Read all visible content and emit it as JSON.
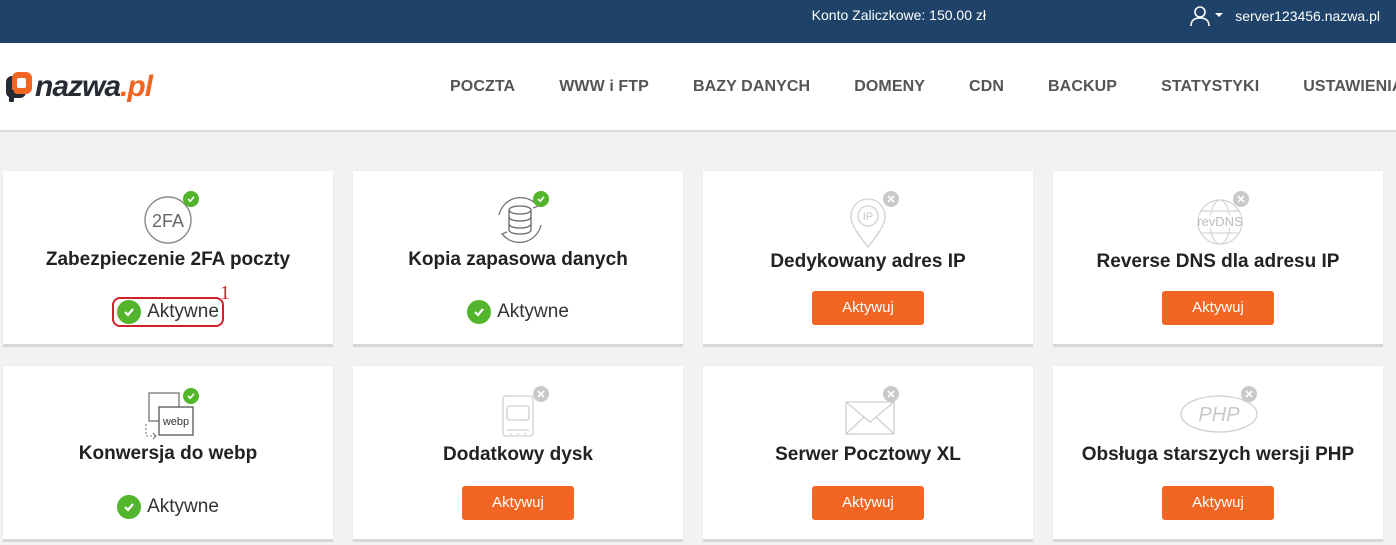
{
  "topbar": {
    "balance": "Konto Zaliczkowe: 150.00 zł",
    "server": "server123456.nazwa.pl"
  },
  "logo": {
    "name": "nazwa",
    "tld": ".pl"
  },
  "nav": [
    "POCZTA",
    "WWW i FTP",
    "BAZY DANYCH",
    "DOMENY",
    "CDN",
    "BACKUP",
    "STATYSTYKI",
    "USTAWIENIA"
  ],
  "colors": {
    "topbar": "#1e4268",
    "accent": "#f26522",
    "success": "#52b52c",
    "inactive": "#c9c9c9",
    "highlight": "#d0222a"
  },
  "cards": [
    {
      "title": "Zabezpieczenie 2FA poczty",
      "icon": "2fa-icon",
      "icon_text": "2FA",
      "active": true,
      "status": "Aktywne"
    },
    {
      "title": "Kopia zapasowa danych",
      "icon": "database-backup-icon",
      "active": true,
      "status": "Aktywne"
    },
    {
      "title": "Dedykowany adres IP",
      "icon": "ip-pin-icon",
      "icon_text": "IP",
      "active": false,
      "button": "Aktywuj"
    },
    {
      "title": "Reverse DNS dla adresu IP",
      "icon": "revdns-globe-icon",
      "icon_text": "revDNS",
      "active": false,
      "button": "Aktywuj"
    },
    {
      "title": "Konwersja do webp",
      "icon": "webp-convert-icon",
      "icon_text": "webp",
      "active": true,
      "status": "Aktywne"
    },
    {
      "title": "Dodatkowy dysk",
      "icon": "disk-drive-icon",
      "active": false,
      "button": "Aktywuj"
    },
    {
      "title": "Serwer Pocztowy XL",
      "icon": "envelope-icon",
      "active": false,
      "button": "Aktywuj"
    },
    {
      "title": "Obsługa starszych wersji PHP",
      "icon": "php-icon",
      "icon_text": "PHP",
      "active": false,
      "button": "Aktywuj"
    }
  ],
  "annotation": {
    "label": "1"
  }
}
